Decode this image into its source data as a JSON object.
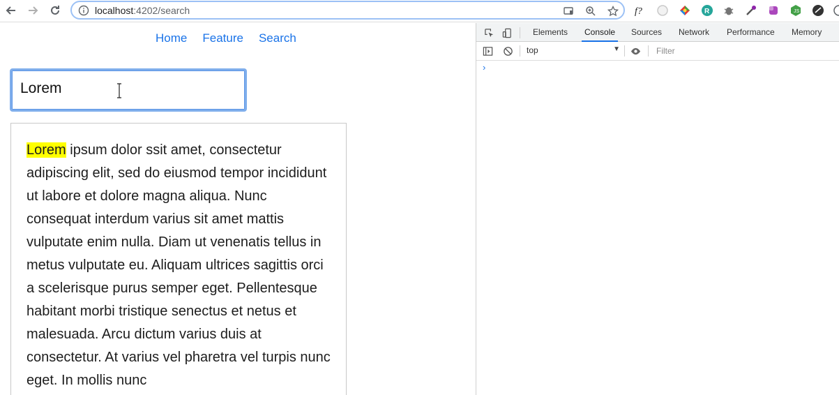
{
  "browser": {
    "url_host": "localhost",
    "url_rest": ":4202/search"
  },
  "page": {
    "nav": {
      "home": "Home",
      "feature": "Feature",
      "search": "Search"
    },
    "search": {
      "value": "Lorem"
    },
    "result": {
      "highlight": "Lorem",
      "text": " ipsum dolor ssit amet, consectetur adipiscing elit, sed do eiusmod tempor incididunt ut labore et dolore magna aliqua. Nunc consequat interdum varius sit amet mattis vulputate enim nulla. Diam ut venenatis tellus in metus vulputate eu. Aliquam ultrices sagittis orci a scelerisque purus semper eget. Pellentesque habitant morbi tristique senectus et netus et malesuada. Arcu dictum varius duis at consectetur. At varius vel pharetra vel turpis nunc eget. In mollis nunc"
    }
  },
  "devtools": {
    "tabs": [
      "Elements",
      "Console",
      "Sources",
      "Network",
      "Performance",
      "Memory"
    ],
    "active_tab": "Console",
    "context": "top",
    "filter_placeholder": "Filter",
    "prompt": "›"
  },
  "colors": {
    "link": "#1a73e8",
    "highlight": "#ffff00",
    "focus_ring": "#7faeec"
  }
}
